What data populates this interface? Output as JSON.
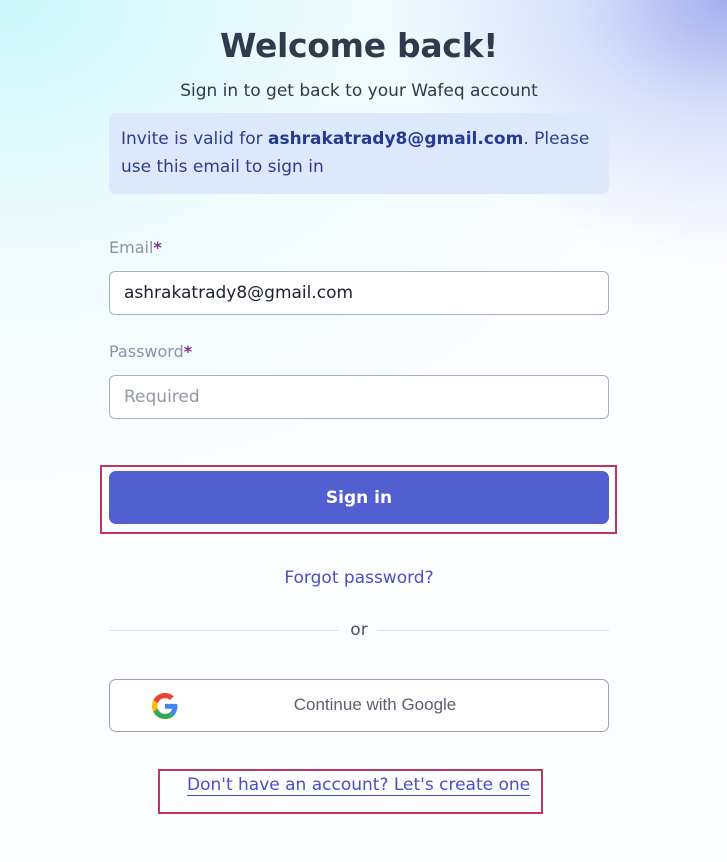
{
  "header": {
    "title": "Welcome back!",
    "subtitle": "Sign in to get back to your Wafeq account"
  },
  "invite": {
    "prefix": "Invite is valid for ",
    "email": "ashrakatrady8@gmail.com",
    "suffix": ". Please use this email to sign in"
  },
  "form": {
    "email_label": "Email",
    "email_value": "ashrakatrady8@gmail.com",
    "password_label": "Password",
    "password_placeholder": "Required",
    "required_marker": "*",
    "signin_label": "Sign in",
    "forgot_label": "Forgot password?"
  },
  "divider": {
    "label": "or"
  },
  "google": {
    "label": "Continue with Google"
  },
  "signup": {
    "label": "Don't have an account? Let's create one"
  },
  "colors": {
    "accent": "#515fd0",
    "link": "#4a4fc2",
    "highlight": "#c0345e",
    "invite_bg": "#dde8fc"
  }
}
